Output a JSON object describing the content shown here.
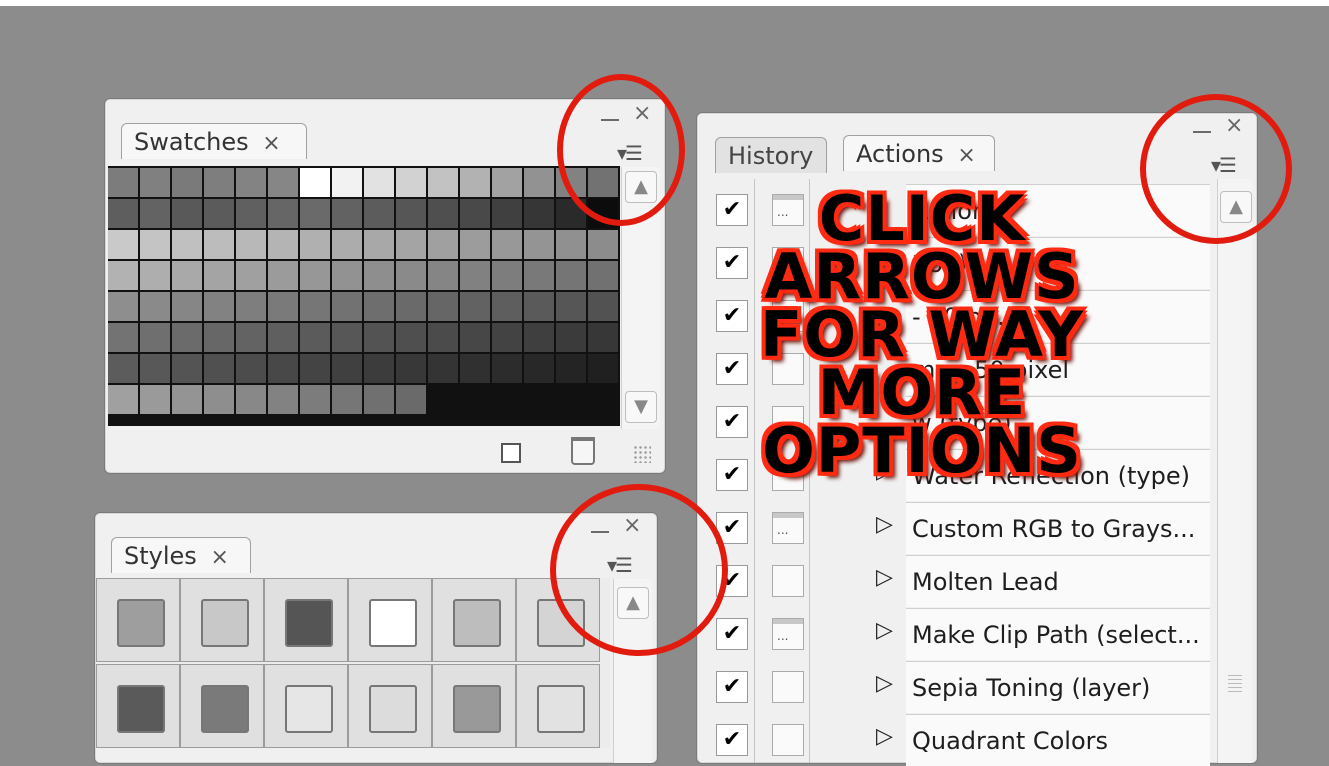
{
  "swatches_panel": {
    "tab_label": "Swatches",
    "tab_close": "×",
    "minimize": "–",
    "close": "×",
    "menu_icon": "▾☰",
    "new_swatch_icon": "new-swatch-icon",
    "delete_icon": "trash-icon",
    "colors": [
      [
        "#7c7c7c",
        "#808080",
        "#7a7a7a",
        "#7e7e7e",
        "#838383",
        "#868686",
        "#ffffff",
        "#f2f2f2",
        "#e2e2e2",
        "#d2d2d2",
        "#c2c2c2",
        "#b2b2b2",
        "#a2a2a2",
        "#929292",
        "#828282",
        "#727272"
      ],
      [
        "#5e5e5e",
        "#636363",
        "#595959",
        "#5b5b5b",
        "#606060",
        "#666666",
        "#6a6a6a",
        "#626262",
        "#5c5c5c",
        "#565656",
        "#4f4f4f",
        "#494949",
        "#404040",
        "#363636",
        "#2a2a2a",
        "#0c0c0c"
      ],
      [
        "#c9c9c9",
        "#c4c4c4",
        "#c0c0c0",
        "#bcbcbc",
        "#b8b8b8",
        "#b4b4b4",
        "#b0b0b0",
        "#acacac",
        "#a8a8a8",
        "#a4a4a4",
        "#a0a0a0",
        "#9c9c9c",
        "#989898",
        "#949494",
        "#909090",
        "#8c8c8c"
      ],
      [
        "#b2b2b2",
        "#aeaeae",
        "#a9a9a9",
        "#a4a4a4",
        "#a0a0a0",
        "#9b9b9b",
        "#979797",
        "#929292",
        "#8e8e8e",
        "#8a8a8a",
        "#858585",
        "#818181",
        "#7d7d7d",
        "#797979",
        "#757575",
        "#717171"
      ],
      [
        "#8e8e8e",
        "#8a8a8a",
        "#868686",
        "#828282",
        "#7e7e7e",
        "#7a7a7a",
        "#767676",
        "#727272",
        "#6e6e6e",
        "#6a6a6a",
        "#666666",
        "#626262",
        "#5e5e5e",
        "#5a5a5a",
        "#565656",
        "#525252"
      ],
      [
        "#737373",
        "#6f6f6f",
        "#6b6b6b",
        "#676767",
        "#636363",
        "#5f5f5f",
        "#5b5b5b",
        "#575757",
        "#535353",
        "#4f4f4f",
        "#4b4b4b",
        "#474747",
        "#434343",
        "#3f3f3f",
        "#3b3b3b",
        "#373737"
      ],
      [
        "#5c5c5c",
        "#585858",
        "#545454",
        "#505050",
        "#4c4c4c",
        "#484848",
        "#444444",
        "#404040",
        "#3c3c3c",
        "#383838",
        "#343434",
        "#303030",
        "#2c2c2c",
        "#282828",
        "#242424",
        "#202020"
      ],
      [
        "#a0a0a0",
        "#9a9a9a",
        "#949494",
        "#8e8e8e",
        "#888888",
        "#828282",
        "#7c7c7c",
        "#767676",
        "#707070",
        "#6a6a6a"
      ]
    ]
  },
  "styles_panel": {
    "tab_label": "Styles",
    "tab_close": "×",
    "minimize": "–",
    "close": "×",
    "menu_icon": "▾☰",
    "styles": [
      {
        "name": "default-style",
        "bg": "#9e9e9e"
      },
      {
        "name": "blurred-style",
        "bg": "#c8c8c8"
      },
      {
        "name": "noise-style",
        "bg": "#555555"
      },
      {
        "name": "white-glow-style",
        "bg": "#ffffff"
      },
      {
        "name": "soft-gray-style",
        "bg": "#bdbdbd"
      },
      {
        "name": "bevel-style",
        "bg": "#d4d4d4"
      },
      {
        "name": "frame-style",
        "bg": "#5a5a5a"
      },
      {
        "name": "gradient-style",
        "bg": "#7a7a7a"
      },
      {
        "name": "light-button-style",
        "bg": "#e6e6e6"
      },
      {
        "name": "flat-button-style",
        "bg": "#dcdcdc"
      },
      {
        "name": "thick-outline-style",
        "bg": "#999999"
      },
      {
        "name": "thin-outline-style",
        "bg": "#e2e2e2"
      }
    ]
  },
  "actions_panel": {
    "tabs": [
      {
        "label": "History"
      },
      {
        "label": "Actions",
        "close": "×"
      }
    ],
    "minimize": "–",
    "close": "×",
    "menu_icon": "▾☰",
    "rows": [
      {
        "label": "Actions",
        "dialog": true,
        "triangle": ""
      },
      {
        "label": "tion)",
        "dialog": false,
        "triangle": ""
      },
      {
        "label": "- 50 p...",
        "dialog": false,
        "triangle": ""
      },
      {
        "label": "me - 50 pixel",
        "dialog": false,
        "triangle": ""
      },
      {
        "label": "w (type)",
        "dialog": false,
        "triangle": ""
      },
      {
        "label": "Water Reflection (type)",
        "dialog": false,
        "triangle": "▷"
      },
      {
        "label": "Custom RGB to Grays...",
        "dialog": true,
        "triangle": "▷"
      },
      {
        "label": "Molten Lead",
        "dialog": false,
        "triangle": "▷"
      },
      {
        "label": "Make Clip Path (select...",
        "dialog": true,
        "triangle": "▷"
      },
      {
        "label": "Sepia Toning (layer)",
        "dialog": false,
        "triangle": "▷"
      },
      {
        "label": "Quadrant Colors",
        "dialog": false,
        "triangle": "▷"
      }
    ],
    "check_mark": "✔"
  },
  "callout": {
    "lines": [
      "CLICK",
      "ARROWS",
      "FOR WAY",
      "MORE",
      "OPTIONS"
    ],
    "color_fill": "#000000",
    "color_outline": "#ff2a12"
  },
  "annotation_color": "#e11b0e"
}
